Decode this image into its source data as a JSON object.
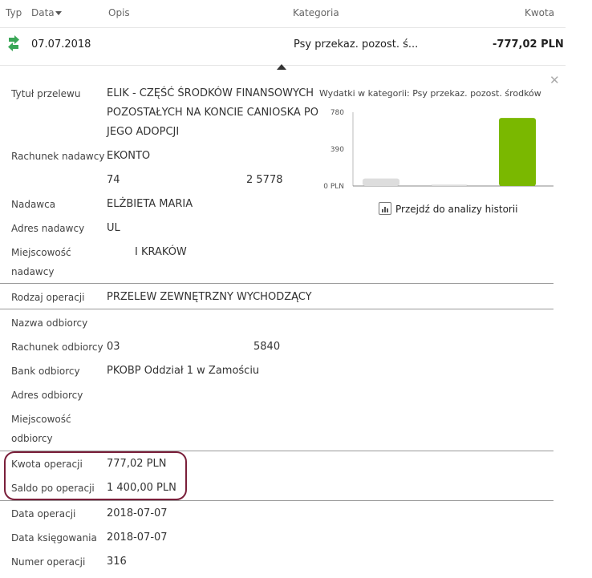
{
  "header": {
    "typ": "Typ",
    "data": "Data",
    "opis": "Opis",
    "kategoria": "Kategoria",
    "kwota": "Kwota"
  },
  "row": {
    "date": "07.07.2018",
    "category": "Psy przekaz. pozost. ś...",
    "amount": "-777,02 PLN"
  },
  "details": {
    "tytul_label": "Tytuł przelewu",
    "tytul_line1": "ELIK - CZĘŚĆ ŚRODKÓW FINANSOWYCH",
    "tytul_line2": "POZOSTAŁYCH NA KONCIE CANIOSKA PO",
    "tytul_line3": "JEGO ADOPCJI",
    "rachunek_nadawcy_label": "Rachunek nadawcy",
    "rachunek_nadawcy_name": "EKONTO",
    "rachunek_nadawcy_num_a": "74",
    "rachunek_nadawcy_num_b": "2 5778",
    "nadawca_label": "Nadawca",
    "nadawca_value": "ELŻBIETA MARIA",
    "adres_nadawcy_label": "Adres nadawcy",
    "adres_nadawcy_value": "UL",
    "miejscowosc_label_1": "Miejscowość",
    "miejscowosc_label_2": "nadawcy",
    "miejscowosc_value": "I  KRAKÓW",
    "rodzaj_label": "Rodzaj operacji",
    "rodzaj_value": "PRZELEW ZEWNĘTRZNY WYCHODZĄCY",
    "nazwa_odbiorcy_label": "Nazwa odbiorcy",
    "rachunek_odbiorcy_label": "Rachunek odbiorcy",
    "rachunek_odbiorcy_a": "03",
    "rachunek_odbiorcy_b": "5840",
    "bank_label": "Bank odbiorcy",
    "bank_value": "PKOBP Oddział 1 w Zamościu",
    "adres_odbiorcy_label": "Adres odbiorcy",
    "miejscowosc_odb_label_1": "Miejscowość",
    "miejscowosc_odb_label_2": "odbiorcy",
    "kwota_label": "Kwota operacji",
    "kwota_value": "777,02 PLN",
    "saldo_label": "Saldo po operacji",
    "saldo_value": "1 400,00 PLN",
    "data_op_label": "Data operacji",
    "data_op_value": "2018-07-07",
    "data_ks_label": "Data księgowania",
    "data_ks_value": "2018-07-07",
    "numer_label": "Numer operacji",
    "numer_value": "316"
  },
  "chart": {
    "title": "Wydatki w kategorii:  Psy przekaz. pozost. środków",
    "link": "Przejdź do analizy historii"
  },
  "colors": {
    "accent_green": "#7ab800",
    "gray_bar": "#dddddd",
    "highlight": "#7a1f3a"
  },
  "chart_data": {
    "type": "bar",
    "title": "Wydatki w kategorii:  Psy przekaz. pozost. środków",
    "categories": [
      "",
      "",
      ""
    ],
    "values": [
      80,
      15,
      720
    ],
    "colors": [
      "#dddddd",
      "#dddddd",
      "#7ab800"
    ],
    "yticks": [
      "0 PLN",
      "390",
      "780"
    ],
    "ylim": [
      0,
      780
    ]
  }
}
